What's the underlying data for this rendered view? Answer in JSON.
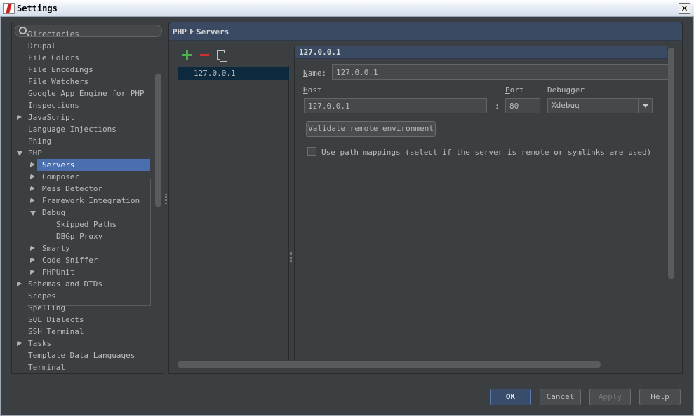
{
  "window": {
    "title": "Settings",
    "close_glyph": "✕"
  },
  "search": {
    "placeholder": "",
    "value": ""
  },
  "tree": {
    "items": [
      {
        "label": "Directories",
        "level": 0,
        "arrow": "none"
      },
      {
        "label": "Drupal",
        "level": 0,
        "arrow": "none"
      },
      {
        "label": "File Colors",
        "level": 0,
        "arrow": "none"
      },
      {
        "label": "File Encodings",
        "level": 0,
        "arrow": "none"
      },
      {
        "label": "File Watchers",
        "level": 0,
        "arrow": "none"
      },
      {
        "label": "Google App Engine for PHP",
        "level": 0,
        "arrow": "none"
      },
      {
        "label": "Inspections",
        "level": 0,
        "arrow": "none"
      },
      {
        "label": "JavaScript",
        "level": 0,
        "arrow": "right"
      },
      {
        "label": "Language Injections",
        "level": 0,
        "arrow": "none"
      },
      {
        "label": "Phing",
        "level": 0,
        "arrow": "none"
      },
      {
        "label": "PHP",
        "level": 0,
        "arrow": "down"
      },
      {
        "label": "Servers",
        "level": 1,
        "arrow": "right",
        "selected": true
      },
      {
        "label": "Composer",
        "level": 1,
        "arrow": "right"
      },
      {
        "label": "Mess Detector",
        "level": 1,
        "arrow": "right"
      },
      {
        "label": "Framework Integration",
        "level": 1,
        "arrow": "right"
      },
      {
        "label": "Debug",
        "level": 1,
        "arrow": "down"
      },
      {
        "label": "Skipped Paths",
        "level": 2,
        "arrow": "none"
      },
      {
        "label": "DBGp Proxy",
        "level": 2,
        "arrow": "none"
      },
      {
        "label": "Smarty",
        "level": 1,
        "arrow": "right"
      },
      {
        "label": "Code Sniffer",
        "level": 1,
        "arrow": "right"
      },
      {
        "label": "PHPUnit",
        "level": 1,
        "arrow": "right"
      },
      {
        "label": "Schemas and DTDs",
        "level": 0,
        "arrow": "right"
      },
      {
        "label": "Scopes",
        "level": 0,
        "arrow": "none"
      },
      {
        "label": "Spelling",
        "level": 0,
        "arrow": "none"
      },
      {
        "label": "SQL Dialects",
        "level": 0,
        "arrow": "none"
      },
      {
        "label": "SSH Terminal",
        "level": 0,
        "arrow": "none"
      },
      {
        "label": "Tasks",
        "level": 0,
        "arrow": "right"
      },
      {
        "label": "Template Data Languages",
        "level": 0,
        "arrow": "none"
      },
      {
        "label": "Terminal",
        "level": 0,
        "arrow": "none"
      }
    ]
  },
  "breadcrumb": {
    "parent": "PHP",
    "current": "Servers"
  },
  "servers": {
    "items": [
      "127.0.0.1"
    ],
    "selected_header": "127.0.0.1"
  },
  "form": {
    "name_label_u": "N",
    "name_label_rest": "ame:",
    "name_value": "127.0.0.1",
    "host_label_u": "H",
    "host_label_rest": "ost",
    "host_value": "127.0.0.1",
    "colon": ":",
    "port_label_u": "P",
    "port_label_rest": "ort",
    "port_value": "80",
    "debugger_label": "Debugger",
    "debugger_value": "Xdebug",
    "validate_u": "V",
    "validate_rest": "alidate remote environment",
    "path_mapping_label": "Use path mappings (select if the server is remote or symlinks are used)"
  },
  "footer": {
    "ok": "OK",
    "cancel": "Cancel",
    "apply": "Apply",
    "help": "Help"
  },
  "colors": {
    "selection": "#4b6eaf",
    "header": "#3a4a62",
    "background": "#3c3f41",
    "add": "#4cb14b",
    "remove": "#d0302f"
  }
}
